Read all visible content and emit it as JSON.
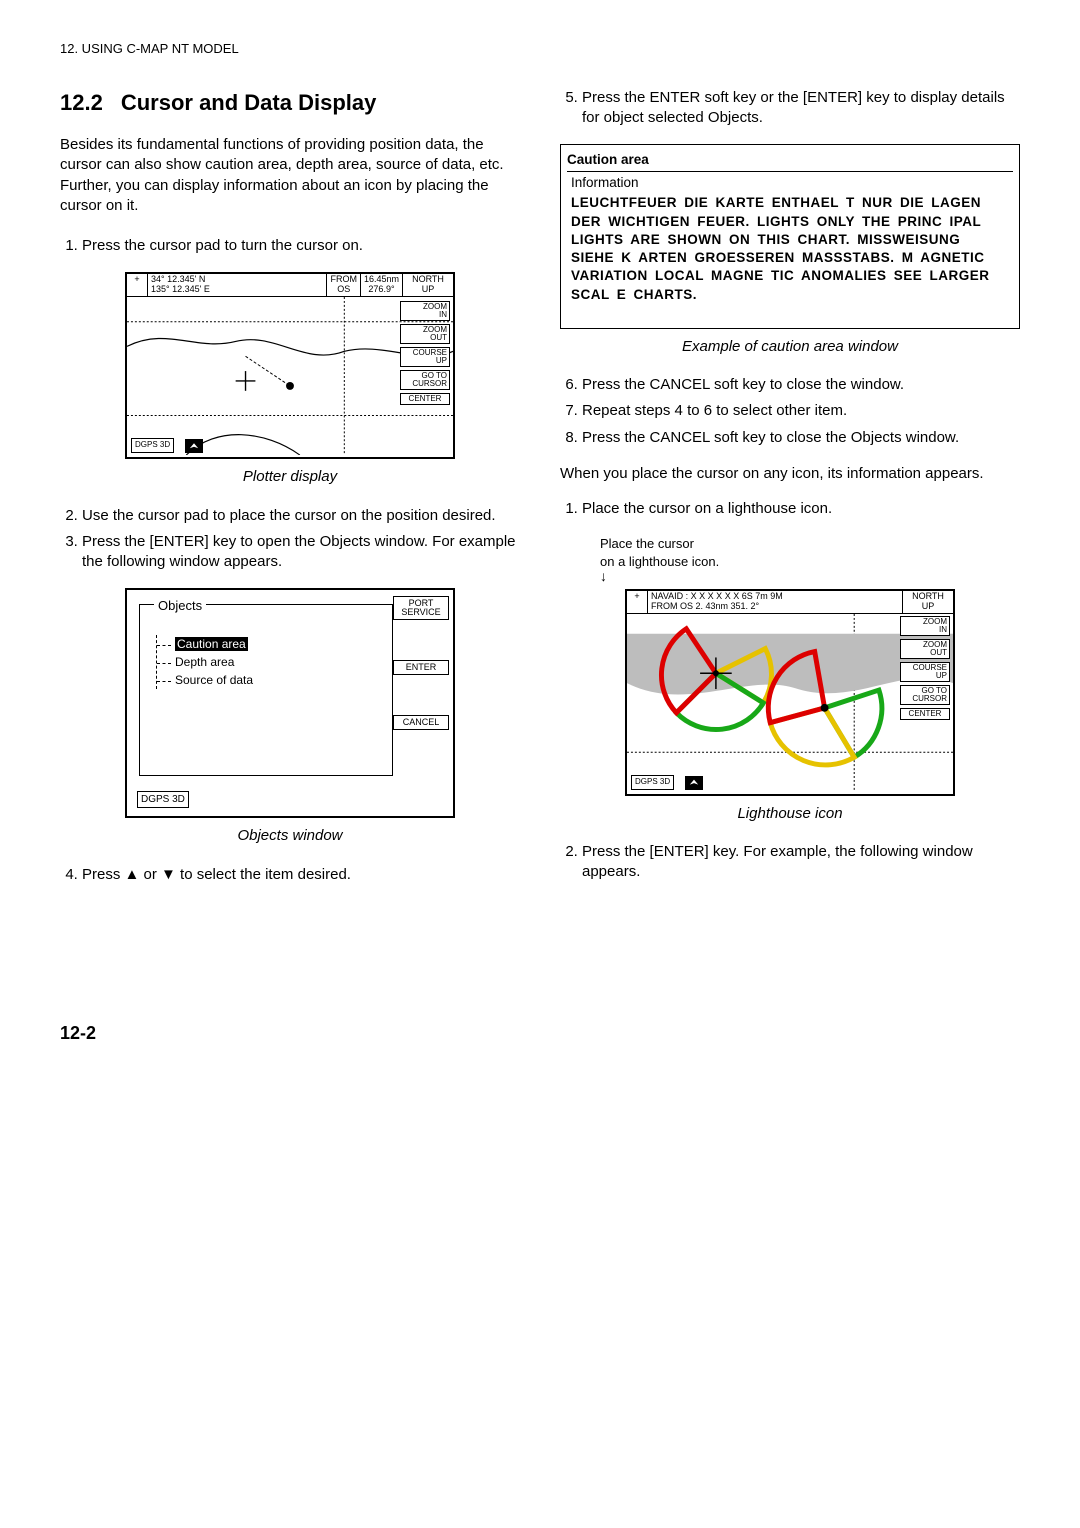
{
  "running_head": "12. USING C-MAP NT MODEL",
  "section_number": "12.2",
  "section_title": "Cursor and Data Display",
  "intro": "Besides its fundamental functions of providing position data, the cursor can also show caution area, depth area, source of data, etc. Further, you can display information about an icon by placing the cursor on it.",
  "left_steps_a": [
    "Press the cursor pad to turn the cursor on."
  ],
  "plotter1": {
    "lat": "34° 12.345' N",
    "lon": "135° 12.345' E",
    "from_label": "FROM",
    "os_label": "OS",
    "range": "16.45nm",
    "bearing": "276.9°",
    "north": "NORTH",
    "up": "UP",
    "softkeys": [
      "ZOOM\nIN",
      "ZOOM\nOUT",
      "COURSE\nUP",
      "GO TO\nCURSOR",
      "CENTER"
    ],
    "dgps": "DGPS 3D"
  },
  "plotter1_caption": "Plotter display",
  "left_steps_b": [
    "Use the cursor pad to place the cursor on the position desired.",
    "Press the [ENTER] key to open the Objects window. For example the following window appears."
  ],
  "objects_window": {
    "title": "Objects",
    "items": [
      "Caution area",
      "Depth area",
      "Source of data"
    ],
    "softkeys": [
      "PORT\nSERVICE",
      "ENTER",
      "CANCEL"
    ],
    "dgps": "DGPS 3D"
  },
  "objects_caption": "Objects window",
  "left_steps_c": [
    "Press ▲ or ▼ to select the item desired."
  ],
  "right_steps_a": [
    "Press the ENTER soft key or the [ENTER] key to display details for object selected Objects."
  ],
  "caution": {
    "header": "Caution area",
    "info": "Information",
    "body": "LEUCHTFEUER DIE KARTE ENTHAEL T NUR DIE LAGEN DER WICHTIGEN FEUER. LIGHTS ONLY THE PRINC IPAL LIGHTS ARE SHOWN ON THIS CHART. MISSWEISUNG SIEHE K ARTEN GROESSEREN MASSSTABS. M AGNETIC VARIATION LOCAL MAGNE TIC ANOMALIES SEE LARGER SCAL E CHARTS."
  },
  "caution_caption": "Example of caution area window",
  "right_steps_b": [
    "Press the CANCEL soft key to close the window.",
    "Repeat steps 4 to 6 to select other item.",
    "Press the CANCEL soft key to close the Objects window."
  ],
  "right_paragraph": "When you place the cursor on any icon, its information appears.",
  "right_steps_c": [
    "Place the cursor on a lighthouse icon."
  ],
  "lighthouse_hint1": "Place the cursor",
  "lighthouse_hint2": "on a lighthouse icon.",
  "plotter2": {
    "navaid": "NAVAID : X X X X X X  6S  7m  9M",
    "from_os": "FROM  OS     2. 43nm        351. 2°",
    "north": "NORTH",
    "up": "UP",
    "softkeys": [
      "ZOOM\nIN",
      "ZOOM\nOUT",
      "COURSE\nUP",
      "GO TO\nCURSOR",
      "CENTER"
    ],
    "dgps": "DGPS 3D"
  },
  "lighthouse_caption": "Lighthouse icon",
  "right_steps_d": [
    "Press the [ENTER] key. For example, the following window appears."
  ],
  "page_number": "12-2"
}
